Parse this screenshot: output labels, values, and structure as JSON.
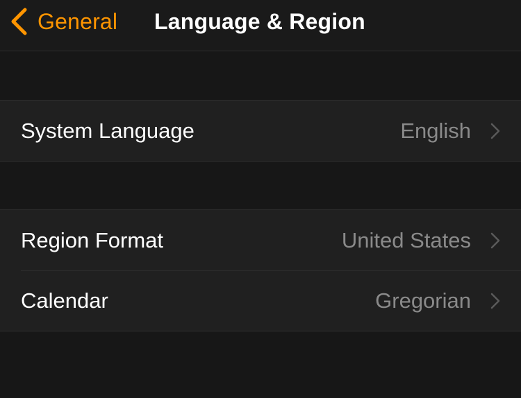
{
  "nav": {
    "back_label": "General",
    "title": "Language & Region"
  },
  "colors": {
    "accent": "#ff9500",
    "background": "#171717",
    "cell_background": "#202020",
    "separator": "#2e2e2e",
    "value_text": "#8a8a8a"
  },
  "groups": [
    {
      "rows": [
        {
          "label": "System Language",
          "value": "English",
          "icon": "chevron-right-icon"
        }
      ]
    },
    {
      "rows": [
        {
          "label": "Region Format",
          "value": "United States",
          "icon": "chevron-right-icon"
        },
        {
          "label": "Calendar",
          "value": "Gregorian",
          "icon": "chevron-right-icon"
        }
      ]
    }
  ]
}
